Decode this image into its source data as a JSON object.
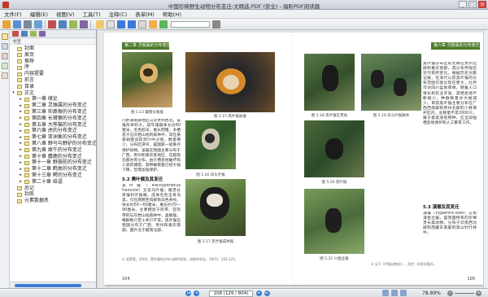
{
  "window": {
    "title": "中国珍稀野生动物分布变迁-文精选.PDF (安全) - 福昕PDF阅读器",
    "controls": [
      "_",
      "□",
      "×"
    ]
  },
  "menu": [
    "文件(F)",
    "编辑(E)",
    "视图(V)",
    "工具(T)",
    "注释(C)",
    "表单(M)",
    "帮助(H)"
  ],
  "toolbar": {
    "search_placeholder": ""
  },
  "sidebar": {
    "label": "书签",
    "items": [
      {
        "label": "封面",
        "level": 0,
        "expandable": false
      },
      {
        "label": "扉页",
        "level": 0,
        "expandable": false
      },
      {
        "label": "推荐",
        "level": 0,
        "expandable": false
      },
      {
        "label": "序",
        "level": 0,
        "expandable": false
      },
      {
        "label": "内容提要",
        "level": 0,
        "expandable": false
      },
      {
        "label": "前言",
        "level": 0,
        "expandable": false
      },
      {
        "label": "目录",
        "level": 0,
        "expandable": false
      },
      {
        "label": "正文",
        "level": 0,
        "expandable": true
      },
      {
        "label": "第一章 绪论",
        "level": 1,
        "expandable": true
      },
      {
        "label": "第二章 灵猴属的分布变迁",
        "level": 1,
        "expandable": true
      },
      {
        "label": "第三章 仰鼻猴的分布变迁",
        "level": 1,
        "expandable": true
      },
      {
        "label": "第四章 长臂猿的分布变迁",
        "level": 1,
        "expandable": true
      },
      {
        "label": "第五章 大熊猫的分布变迁",
        "level": 1,
        "expandable": true
      },
      {
        "label": "第六章 虎的分布变迁",
        "level": 1,
        "expandable": true
      },
      {
        "label": "第七章 亚洲象的分布变迁",
        "level": 1,
        "expandable": true
      },
      {
        "label": "第八章 野马与野驴的分布变迁",
        "level": 1,
        "expandable": true
      },
      {
        "label": "第九章 犀牛的分布变迁",
        "level": 1,
        "expandable": true
      },
      {
        "label": "第十章 麋鹿的分布变迁",
        "level": 1,
        "expandable": true
      },
      {
        "label": "第十一章 野骆驼的分布变迁",
        "level": 1,
        "expandable": true
      },
      {
        "label": "第十二章 鹤类的分布变迁",
        "level": 1,
        "expandable": true
      },
      {
        "label": "第十三章 鳄的分布变迁",
        "level": 1,
        "expandable": true
      },
      {
        "label": "第二十章 结语",
        "level": 1,
        "expandable": true
      },
      {
        "label": "后记",
        "level": 0,
        "expandable": false
      },
      {
        "label": "封底",
        "level": 0,
        "expandable": false
      },
      {
        "label": "元素数据名",
        "level": 0,
        "expandable": false
      }
    ]
  },
  "left_page": {
    "header_label": "第二章 灵猴属的分布变迁",
    "captions": [
      "图 5.13 藏南长尾猴",
      "图 5.15 黑叶猴幼猴",
      "图 5.16 白头叶猴",
      "图 5.17 黑叶猴成体猴"
    ],
    "body": "川黔滇南部地区以及贵州西北。该猴形体较大，成年雄猴体长达60厘米。毛色较深，尾长而粗，多栖息于石灰岩山地的森林中，常在悬崖峭壁间的洞穴中过夜。数量稀少，分布区狭窄，是国家一级重点保护动物。该猴在我国主要分布于广西、贵州和重庆等地区，在越南北部亦有分布。由于栖息地破坏和人类的捕猎，其种群数量已经大幅下降，急需加强保护。",
    "section_heading": "5.2 黑叶猴及其变迁",
    "body2": "黑叶猴（Trachypithecus francoisi）又名乌叶猴，属灵长目猴科叶猴属。成体毛色全身乌黑，仅在两颊至耳部有白色条纹。体长约50～60厘米，尾长约70～90厘米。主要栖息于热带、亚热带的石灰岩山地森林中，喜群居，每群数只至十余只不等。黑叶猴在我国分布于广西、贵州和重庆南部，国外见于越南北部。",
    "footnote": "① 吴毅等，2004，黑叶猴的分布与保护现状。动物学杂志，39(3)：120-125。",
    "page_number": "104"
  },
  "right_page": {
    "header_label": "第六章 灵猴属的分布变迁",
    "captions": [
      "图 5.18 黑叶猴在觅食",
      "图 5.19 白头叶猴群体",
      "图 5.20 黑叶猴",
      "图 5.21 川金丝猴"
    ],
    "body": "黑叶猴分布区的北缘在贵州北部和重庆南部，其分布界限在近代有所变化。根据历史文献记载，在清代以前黑叶猴的分布范围可能比现在更大，北界可达四川盆地南缘。随着人口增长和农业开发，其栖息地不断缩小，种群数量亦大幅减少。目前黑叶猴主要分布在广西西南部和贵州北部的少数保护区内，总数量不足2000只，属于极度濒危物种，应当加强栖息地保护和人工繁育工作。",
    "section_heading": "5.3 滇猴及其变迁",
    "body2": "滇猴（Pygathrix bieti）又称滇金丝猴，是我国特有的珍稀灵长类动物，分布于云南西北部和西藏东南部的高山针叶林中。",
    "footnote": "① 见于《中国动物志》，北京：科学出版社。",
    "page_number": "105"
  },
  "status": {
    "page_indicator": "108 (129 / 804)",
    "zoom": "78.89%"
  }
}
